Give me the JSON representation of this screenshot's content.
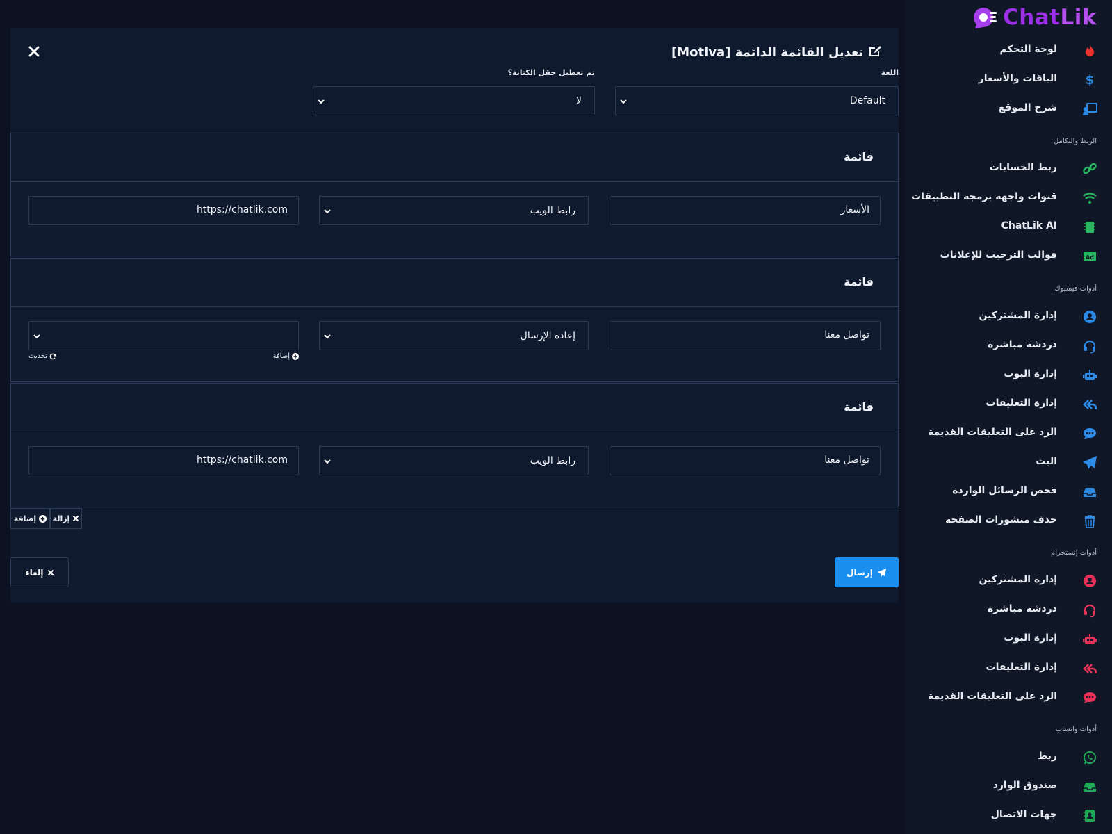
{
  "brand": {
    "name_a": "Chat",
    "name_b": "Lik"
  },
  "modal": {
    "title": "تعديل القائمة الدائمة [Motiva]",
    "language_label": "اللغة",
    "language_value": "Default",
    "typing_label": "تم تعطيل حقل الكتابة؟",
    "typing_value": "لا",
    "cards": [
      {
        "title": "قائمة",
        "text": "الأسعار",
        "type": "رابط الويب",
        "value": "https://chatlik.com"
      },
      {
        "title": "قائمة",
        "text": "تواصل معنا",
        "type": "إعادة الإرسال",
        "value": "",
        "add_link": "إضافة",
        "refresh_link": "تحديث"
      },
      {
        "title": "قائمة",
        "text": "تواصل معنا",
        "type": "رابط الويب",
        "value": "https://chatlik.com"
      }
    ],
    "remove_label": "إزالة",
    "add_label": "إضافة",
    "send_label": "إرسال",
    "cancel_label": "إلغاء"
  },
  "sidebar": {
    "items_top": [
      {
        "label": "لوحة التحكم",
        "icon": "fire-icon",
        "color": "#e8322d"
      },
      {
        "label": "الباقات والأسعار",
        "icon": "dollar-icon",
        "color": "#2d8be8"
      },
      {
        "label": "شرح الموقع",
        "icon": "chalkboard-teacher-icon",
        "color": "#2d8be8"
      }
    ],
    "section_integration": "الربط والتكامل",
    "items_integration": [
      {
        "label": "ربط الحسابات",
        "icon": "link-icon",
        "color": "#27b560"
      },
      {
        "label": "قنوات واجهة برمجة التطبيقات",
        "icon": "wifi-icon",
        "color": "#27b560"
      },
      {
        "label": "ChatLik AI",
        "icon": "chip-icon",
        "color": "#27b560"
      },
      {
        "label": "قوالب الترحيب للإعلانات",
        "icon": "ad-icon",
        "color": "#27b560"
      }
    ],
    "section_facebook": "أدوات فيسبوك",
    "items_facebook": [
      {
        "label": "إدارة المشتركين",
        "icon": "user-circle-icon",
        "color": "#2d8be8"
      },
      {
        "label": "دردشة مباشرة",
        "icon": "headset-icon",
        "color": "#2d8be8"
      },
      {
        "label": "إدارة البوت",
        "icon": "robot-icon",
        "color": "#2d8be8"
      },
      {
        "label": "إدارة التعليقات",
        "icon": "reply-all-icon",
        "color": "#2d8be8"
      },
      {
        "label": "الرد على التعليقات القديمة",
        "icon": "comment-dots-icon",
        "color": "#2d8be8"
      },
      {
        "label": "البث",
        "icon": "paper-plane-icon",
        "color": "#2d8be8"
      },
      {
        "label": "فحص الرسائل الواردة",
        "icon": "inbox-icon",
        "color": "#2d8be8"
      },
      {
        "label": "حذف منشورات الصفحة",
        "icon": "trash-icon",
        "color": "#2d8be8"
      }
    ],
    "section_instagram": "أدوات إنستجرام",
    "items_instagram": [
      {
        "label": "إدارة المشتركين",
        "icon": "user-circle-icon",
        "color": "#e8325a"
      },
      {
        "label": "دردشة مباشرة",
        "icon": "headset-icon",
        "color": "#e8325a"
      },
      {
        "label": "إدارة البوت",
        "icon": "robot-icon",
        "color": "#e8325a"
      },
      {
        "label": "إدارة التعليقات",
        "icon": "reply-all-icon",
        "color": "#e8325a"
      },
      {
        "label": "الرد على التعليقات القديمة",
        "icon": "comment-dots-icon",
        "color": "#e8325a"
      }
    ],
    "section_whatsapp": "أدوات واتساب",
    "items_whatsapp": [
      {
        "label": "ربط",
        "icon": "whatsapp-icon",
        "color": "#1fa855"
      },
      {
        "label": "صندوق الوارد",
        "icon": "inbox-icon",
        "color": "#1fa855"
      },
      {
        "label": "جهات الاتصال",
        "icon": "address-book-icon",
        "color": "#1fa855"
      }
    ]
  }
}
